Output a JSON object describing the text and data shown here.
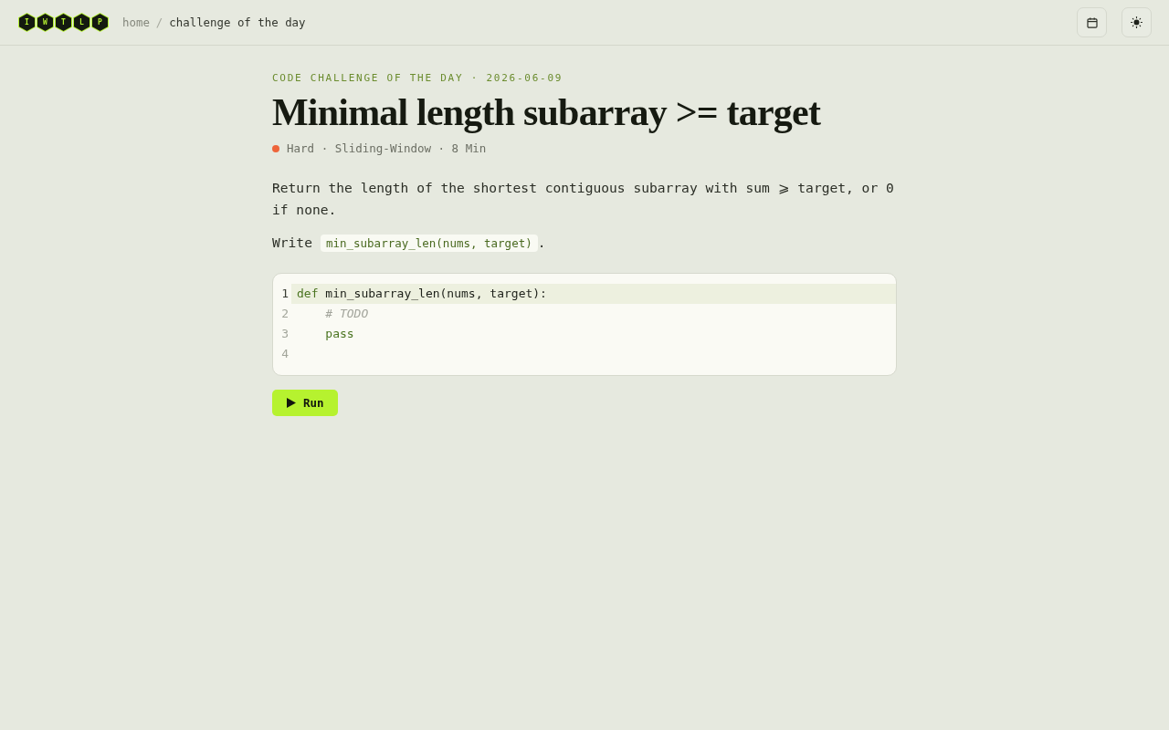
{
  "header": {
    "logo": {
      "letters": [
        "I",
        "W",
        "T",
        "L",
        "P"
      ]
    },
    "breadcrumb": {
      "items": [
        {
          "label": "home",
          "current": false
        },
        {
          "label": "challenge of the day",
          "current": true
        }
      ],
      "separator": "/"
    },
    "actions": [
      {
        "kind": "calendar"
      },
      {
        "kind": "theme"
      }
    ]
  },
  "challenge": {
    "eyebrow": "CODE CHALLENGE OF THE DAY · 2026-06-09",
    "title": "Minimal length subarray >= target",
    "meta": {
      "color": "#ee653a",
      "text": "Hard · Sliding-Window · 8 Min"
    },
    "description": "Return the length of the shortest contiguous subarray with sum ⩾ target, or 0 if none.",
    "instruction": {
      "prefix": "Write",
      "code": "min_subarray_len(nums, target)",
      "suffix": "."
    }
  },
  "editor": {
    "lines": [
      {
        "number": "1",
        "active": true,
        "tokens": [
          {
            "kind": "keyword",
            "text": "def"
          },
          {
            "kind": "plain",
            "text": " min_subarray_len(nums, target):"
          }
        ]
      },
      {
        "number": "2",
        "active": false,
        "tokens": [
          {
            "kind": "comment",
            "text": "    # TODO"
          }
        ]
      },
      {
        "number": "3",
        "active": false,
        "tokens": [
          {
            "kind": "keyword",
            "text": "    pass"
          }
        ]
      },
      {
        "number": "4",
        "active": false
      }
    ]
  },
  "run_button": {
    "label": "Run"
  }
}
